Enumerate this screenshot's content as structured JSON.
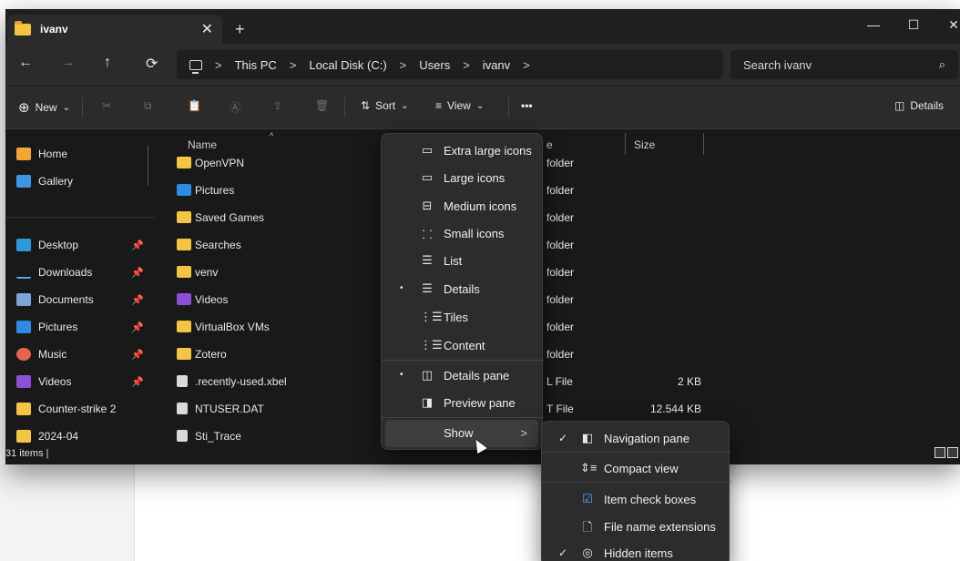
{
  "window": {
    "tab_title": "ivanv",
    "tab_close": "✕",
    "new_tab": "+",
    "minimize": "—",
    "maximize": "☐",
    "close": "✕"
  },
  "address": {
    "back": "←",
    "forward": "→",
    "up": "↑",
    "refresh": "⟳",
    "crumbs": [
      "This PC",
      "Local Disk (C:)",
      "Users",
      "ivanv"
    ],
    "sep": ">",
    "search_placeholder": "Search ivanv",
    "search_icon": "⌕"
  },
  "commandbar": {
    "new_label": "New",
    "new_icon": "⊕",
    "cut_icon": "✂",
    "copy_icon": "⧉",
    "paste_icon": "📋",
    "rename_icon": "Ⓐ",
    "share_icon": "⇪",
    "delete_icon": "🗑",
    "sort_label": "Sort",
    "sort_icon": "⇅",
    "view_label": "View",
    "view_icon": "≡",
    "more_label": "•••",
    "details_label": "Details",
    "details_icon": "◫",
    "dropdown_chevron": "⌄"
  },
  "sidebar": {
    "items": [
      {
        "label": "Home",
        "icon": "home-icon",
        "pinned": false
      },
      {
        "label": "Gallery",
        "icon": "gallery-icon",
        "pinned": false
      },
      {
        "label": "Desktop",
        "icon": "desktop-icon",
        "pinned": true
      },
      {
        "label": "Downloads",
        "icon": "download-icon",
        "pinned": true
      },
      {
        "label": "Documents",
        "icon": "documents-icon",
        "pinned": true
      },
      {
        "label": "Pictures",
        "icon": "pictures-icon",
        "pinned": true
      },
      {
        "label": "Music",
        "icon": "music-icon",
        "pinned": true
      },
      {
        "label": "Videos",
        "icon": "videos-icon",
        "pinned": true
      },
      {
        "label": "Counter-strike 2",
        "icon": "folder-icon",
        "pinned": false
      },
      {
        "label": "2024-04",
        "icon": "folder-icon",
        "pinned": false
      }
    ],
    "pin_glyph": "📌"
  },
  "columns": {
    "name": "Name",
    "type": "e",
    "size": "Size",
    "sort_arrow": "^"
  },
  "files": [
    {
      "name": "OpenVPN",
      "type": "folder",
      "size": "",
      "icon": "folder"
    },
    {
      "name": "Pictures",
      "type": "folder",
      "size": "",
      "icon": "pictures"
    },
    {
      "name": "Saved Games",
      "type": "folder",
      "size": "",
      "icon": "folder"
    },
    {
      "name": "Searches",
      "type": "folder",
      "size": "",
      "icon": "folder"
    },
    {
      "name": "venv",
      "type": "folder",
      "size": "",
      "icon": "folder"
    },
    {
      "name": "Videos",
      "type": "folder",
      "size": "",
      "icon": "videos"
    },
    {
      "name": "VirtualBox VMs",
      "type": "folder",
      "size": "",
      "icon": "folder"
    },
    {
      "name": "Zotero",
      "type": "folder",
      "size": "",
      "icon": "folder"
    },
    {
      "name": ".recently-used.xbel",
      "type": "L File",
      "size": "2 KB",
      "icon": "file"
    },
    {
      "name": "NTUSER.DAT",
      "type": "T File",
      "size": "12.544 KB",
      "icon": "file"
    },
    {
      "name": "Sti_Trace",
      "type": "",
      "size": "",
      "icon": "file"
    }
  ],
  "status": {
    "count": "31 items  |"
  },
  "view_menu": {
    "items": [
      {
        "label": "Extra large icons",
        "icon": "▭",
        "selected": false
      },
      {
        "label": "Large icons",
        "icon": "▭",
        "selected": false
      },
      {
        "label": "Medium icons",
        "icon": "⊟",
        "selected": false
      },
      {
        "label": "Small icons",
        "icon": "⸬",
        "selected": false
      },
      {
        "label": "List",
        "icon": "☰",
        "selected": false
      },
      {
        "label": "Details",
        "icon": "☰",
        "selected": true
      },
      {
        "label": "Tiles",
        "icon": "⋮☰",
        "selected": false
      },
      {
        "label": "Content",
        "icon": "⋮☰",
        "selected": false
      },
      {
        "label": "Details pane",
        "icon": "◫",
        "selected": true
      },
      {
        "label": "Preview pane",
        "icon": "◨",
        "selected": false
      },
      {
        "label": "Show",
        "icon": "",
        "selected": false
      }
    ],
    "bullet": "•",
    "chevron": ">"
  },
  "show_menu": {
    "items": [
      {
        "label": "Navigation pane",
        "icon": "◧",
        "checked": true
      },
      {
        "label": "Compact view",
        "icon": "⇕≡",
        "checked": false
      },
      {
        "label": "Item check boxes",
        "icon": "☑",
        "checked": false
      },
      {
        "label": "File name extensions",
        "icon": "🗋",
        "checked": false
      },
      {
        "label": "Hidden items",
        "icon": "◎",
        "checked": true
      }
    ],
    "check": "✓"
  }
}
